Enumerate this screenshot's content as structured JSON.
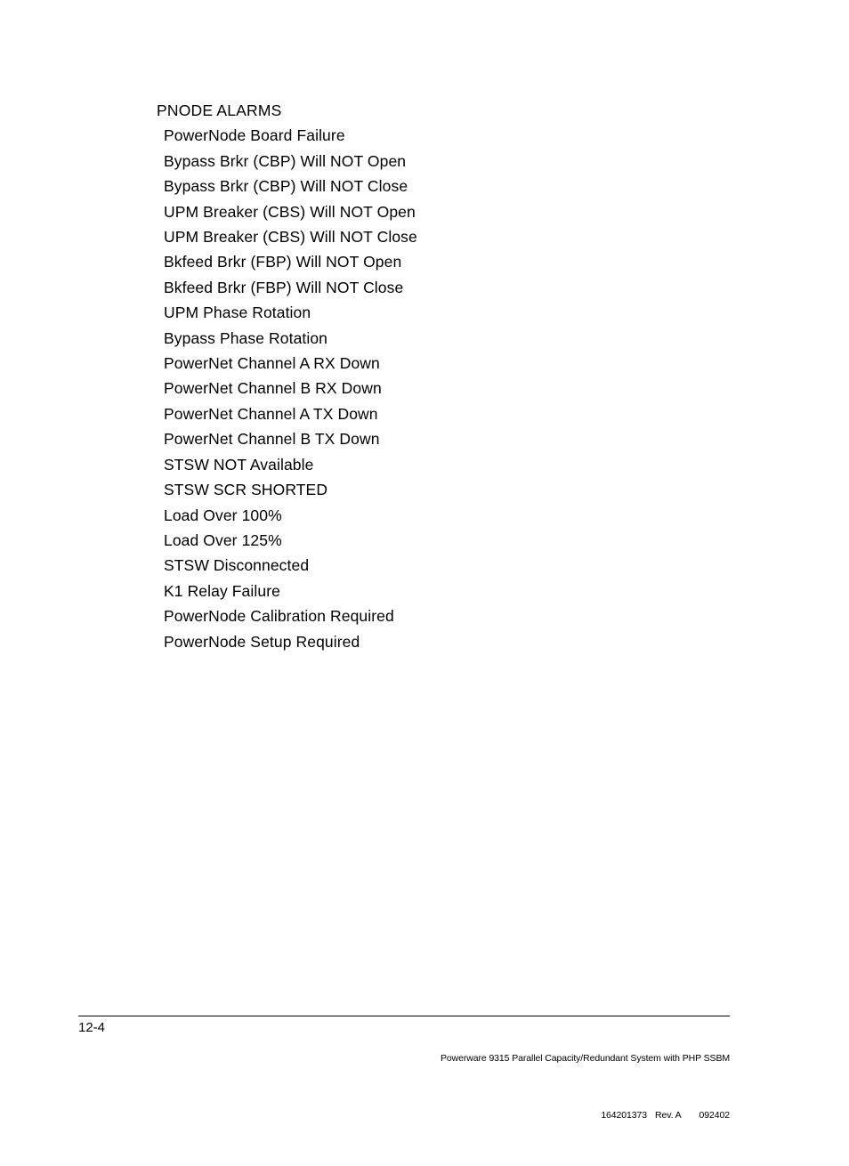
{
  "document": {
    "section_heading": "PNODE ALARMS",
    "alarms": [
      "PowerNode Board Failure",
      "Bypass Brkr (CBP) Will NOT Open",
      "Bypass Brkr (CBP) Will NOT Close",
      "UPM Breaker (CBS) Will NOT Open",
      "UPM Breaker (CBS) Will NOT Close",
      "Bkfeed Brkr (FBP) Will NOT Open",
      "Bkfeed Brkr (FBP) Will NOT Close",
      "UPM Phase Rotation",
      "Bypass Phase Rotation",
      "PowerNet Channel A RX Down",
      "PowerNet Channel B RX Down",
      "PowerNet Channel A TX Down",
      "PowerNet Channel B TX Down",
      "STSW NOT Available",
      "STSW SCR SHORTED",
      "Load Over 100%",
      "Load Over 125%",
      "STSW Disconnected",
      "K1 Relay Failure",
      "PowerNode Calibration Required",
      "PowerNode Setup Required"
    ]
  },
  "footer": {
    "page_number": "12-4",
    "product_title": "Powerware 9315 Parallel Capacity/Redundant System with PHP SSBM",
    "part_number": "164201373",
    "revision": "Rev. A",
    "date_code": "092402"
  },
  "colors": {
    "text": "#000000",
    "background": "#ffffff",
    "rule": "#000000"
  }
}
